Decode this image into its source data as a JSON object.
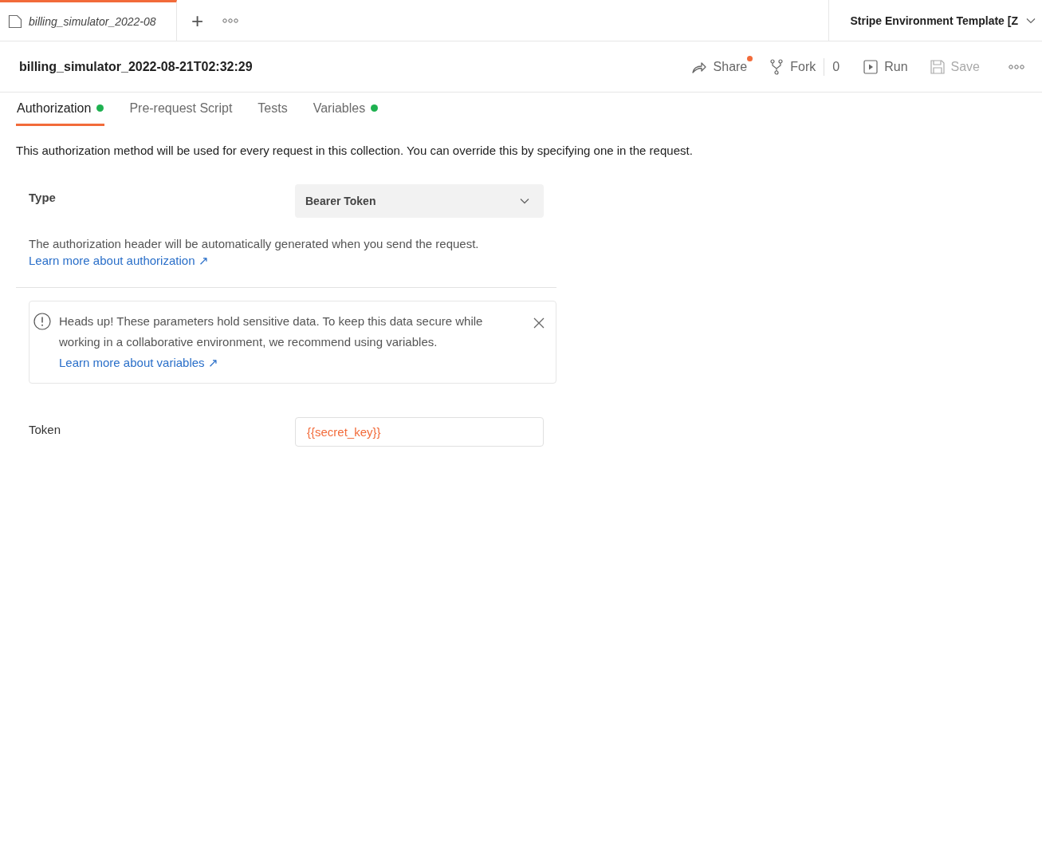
{
  "tab_bar": {
    "open_tab": {
      "title": "billing_simulator_2022-08",
      "selected": true
    },
    "new_tab": "+",
    "environment": "Stripe Environment Template [Z"
  },
  "header": {
    "title": "billing_simulator_2022-08-21T02:32:29",
    "actions": [
      {
        "kind": "share",
        "label": "Share",
        "notify": true,
        "disabled": false
      },
      {
        "kind": "fork",
        "label": "Fork",
        "count": "0",
        "notify": false,
        "disabled": false
      },
      {
        "kind": "run",
        "label": "Run",
        "notify": false,
        "disabled": false
      },
      {
        "kind": "save",
        "label": "Save",
        "notify": false,
        "disabled": true
      }
    ]
  },
  "tabs": [
    {
      "label": "Authorization",
      "selected": true,
      "dot": true
    },
    {
      "label": "Pre-request Script",
      "selected": false,
      "dot": false
    },
    {
      "label": "Tests",
      "selected": false,
      "dot": false
    },
    {
      "label": "Variables",
      "selected": false,
      "dot": true
    }
  ],
  "description": "This authorization method will be used for every request in this collection. You can override this by specifying one in the request.",
  "type_row": {
    "label": "Type",
    "value": "Bearer Token"
  },
  "help": {
    "text": "The authorization header will be automatically generated when you send the request.",
    "link": "Learn more about authorization ↗"
  },
  "notice": {
    "text": "Heads up! These parameters hold sensitive data. To keep this data secure while working in a collaborative environment, we recommend using variables.",
    "link": "Learn more about variables ↗"
  },
  "token": {
    "label": "Token",
    "value": "{{secret_key}}"
  }
}
